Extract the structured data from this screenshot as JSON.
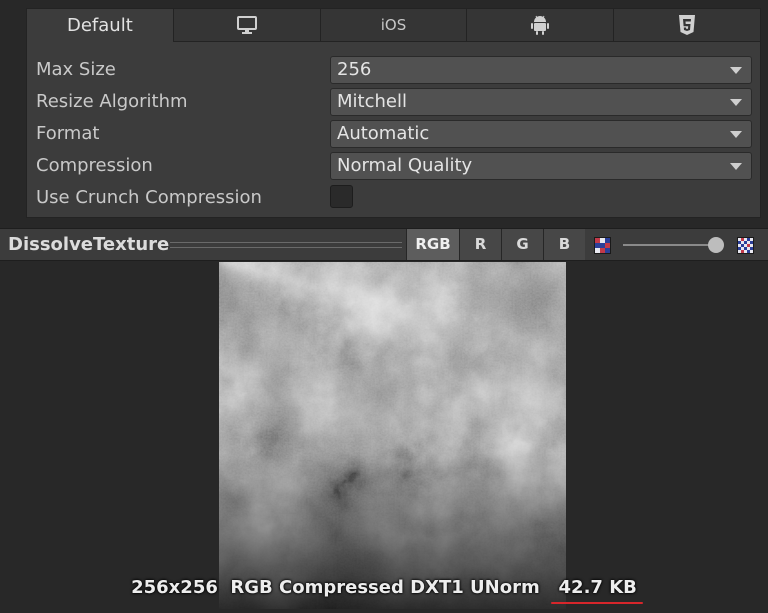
{
  "platform_tabs": [
    {
      "label": "Default",
      "icon": null,
      "active": true
    },
    {
      "label": "",
      "icon": "monitor-icon",
      "active": false
    },
    {
      "label": "iOS",
      "icon": null,
      "active": false
    },
    {
      "label": "",
      "icon": "android-icon",
      "active": false
    },
    {
      "label": "",
      "icon": "html5-icon",
      "active": false
    }
  ],
  "settings": {
    "max_size": {
      "label": "Max Size",
      "value": "256"
    },
    "resize_algorithm": {
      "label": "Resize Algorithm",
      "value": "Mitchell"
    },
    "format": {
      "label": "Format",
      "value": "Automatic"
    },
    "compression": {
      "label": "Compression",
      "value": "Normal Quality"
    },
    "use_crunch": {
      "label": "Use Crunch Compression",
      "checked": false
    }
  },
  "preview": {
    "title": "DissolveTexture",
    "channels": [
      "RGB",
      "R",
      "G",
      "B"
    ],
    "active_channel": "RGB",
    "mip_level": 1.0
  },
  "texture_info": {
    "dimensions": "256x256",
    "format": "RGB Compressed DXT1 UNorm",
    "size": "42.7 KB"
  },
  "colors": {
    "highlight_underline": "#d7262b",
    "panel_bg": "#3c3c3c",
    "window_bg": "#282828"
  }
}
